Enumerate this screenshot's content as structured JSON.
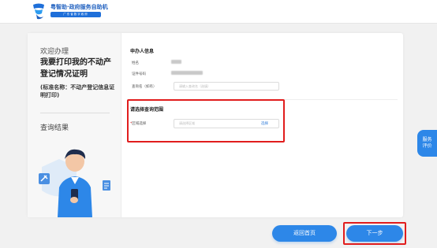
{
  "header": {
    "brand_title": "粤智助·政府服务自助机",
    "brand_subtitle": "广东省数字政府"
  },
  "left_panel": {
    "welcome": "欢迎办理",
    "title": "我要打印我的不动产登记情况证明",
    "note": "(标准名称：不动产登记信息证明打印)",
    "query_results": "查询结果"
  },
  "applicant": {
    "section_title": "申办人信息",
    "name_label": "姓名",
    "id_label": "证件号码",
    "reference_label": "查询名（如有）",
    "reference_placeholder": "请输入查询名（选填）"
  },
  "scope": {
    "section_title": "请选择查询范围",
    "region_label": "区域选择",
    "region_placeholder": "请选择区域",
    "select_label": "选择"
  },
  "footer": {
    "back_label": "返回首页",
    "next_label": "下一步"
  },
  "side": {
    "service_label": "服务评价"
  },
  "colors": {
    "primary": "#2d87e8",
    "highlight": "#e11d1d"
  }
}
